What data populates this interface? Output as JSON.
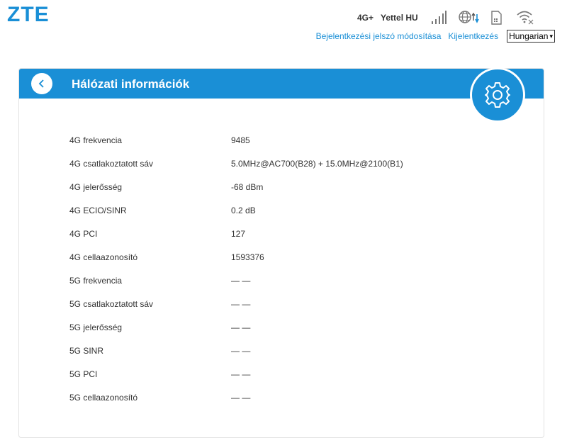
{
  "header": {
    "logo": "ZTE",
    "network_type": "4G+",
    "carrier": "Yettel HU",
    "icons": [
      "signal-icon",
      "globe-data-icon",
      "sim-card-icon",
      "wifi-off-icon"
    ]
  },
  "top_links": {
    "change_password": "Bejelentkezési jelszó módosítása",
    "logout": "Kijelentkezés",
    "language": "Hungarian"
  },
  "panel": {
    "title": "Hálózati információk",
    "rows": [
      {
        "label": "4G frekvencia",
        "value": "9485"
      },
      {
        "label": "4G csatlakoztatott sáv",
        "value": "5.0MHz@AC700(B28) + 15.0MHz@2100(B1)"
      },
      {
        "label": "4G jelerősség",
        "value": "-68 dBm"
      },
      {
        "label": "4G ECIO/SINR",
        "value": "0.2 dB"
      },
      {
        "label": "4G PCI",
        "value": "127"
      },
      {
        "label": "4G cellaazonosító",
        "value": "1593376"
      },
      {
        "label": "5G frekvencia",
        "value": "— —"
      },
      {
        "label": "5G csatlakoztatott sáv",
        "value": "— —"
      },
      {
        "label": "5G jelerősség",
        "value": "— —"
      },
      {
        "label": "5G SINR",
        "value": "— —"
      },
      {
        "label": "5G PCI",
        "value": "— —"
      },
      {
        "label": "5G cellaazonosító",
        "value": "— —"
      }
    ]
  },
  "colors": {
    "accent": "#1a8fd6",
    "text": "#333333",
    "background": "#ffffff"
  }
}
